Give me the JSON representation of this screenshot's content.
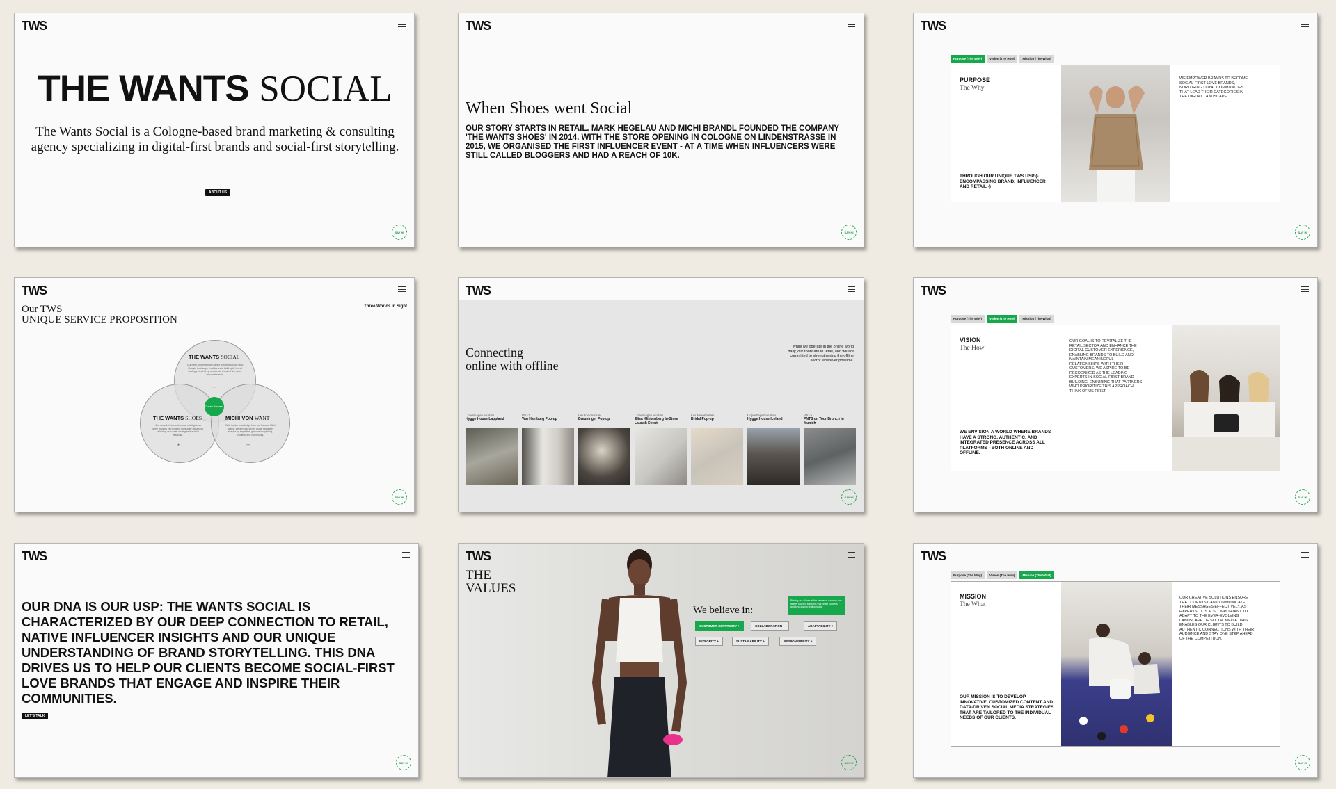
{
  "brand": {
    "logo": "TWS",
    "say_hi": "SAY HI",
    "accent": "#17a84d"
  },
  "hero": {
    "title_bold": "THE WANTS",
    "title_light": "SOCIAL",
    "description": "The Wants Social is a Cologne-based brand marketing & consulting agency specializing in digital-first brands and social-first storytelling.",
    "button": "ABOUT US"
  },
  "story": {
    "heading": "When Shoes went Social",
    "text": "OUR STORY STARTS IN RETAIL. MARK HEGELAU AND MICHI BRANDL FOUNDED THE COMPANY 'THE WANTS SHOES' IN 2014. WITH THE STORE OPENING IN COLOGNE ON LINDENSTRASSE IN 2015, WE ORGANISED THE FIRST INFLUENCER EVENT - AT A TIME WHEN INFLUENCERS WERE STILL CALLED BLOGGERS AND HAD A REACH OF 10K."
  },
  "tabs": [
    "Purpose (The Why)",
    "Vision (The How)",
    "Mission (The What)"
  ],
  "purpose": {
    "heading": "PURPOSE",
    "sub": "The Why",
    "bottom": "THROUGH OUR UNIQUE TWS USP (-ENCOMPASSING BRAND, INFLUENCER AND RETAIL -)",
    "right": "WE EMPOWER BRANDS TO BECOME SOCIAL-FIRST LOVE BRANDS, NURTURING LOYAL COMMUNITIES THAT LEAD THEIR CATEGORIES IN THE DIGITAL LANDSCAPE."
  },
  "usp": {
    "heading_line1": "Our TWS",
    "heading_line2": "UNIQUE SERVICE PROPOSITION",
    "tag": "Three Worlds in Sight",
    "core": "Classic Business",
    "circles": [
      {
        "bold": "THE WANTS",
        "light": "SOCIAL",
        "text": "Our deep understanding of the dynamic fashion and lifestyle landscape enables us to build agile brand strategies that keep our clients ahead of the curve on social media."
      },
      {
        "bold": "THE WANTS",
        "light": "SHOES",
        "text": "Our roots in brick-and-mortar retail give us deep insights into modern consumer behaviour, allowing us to craft strategies that truly resonate."
      },
      {
        "bold": "MICHI VON",
        "light": "WANT",
        "text": "With insider knowledge from our founder Michi Brandl, we develop strong social strategies shaped by expertise, genuine storytelling, content, and community."
      }
    ]
  },
  "connecting": {
    "heading_line1": "Connecting",
    "heading_line2": "online with offline",
    "text": "While we operate in the online world daily, our roots are in retail, and we are committed to strengthening the offline sector wherever possible.",
    "items": [
      {
        "client": "Copenhagen Studios",
        "title": "Hygge House Lappland"
      },
      {
        "client": "PNTS",
        "title": "Vau Hamburg Pop-up"
      },
      {
        "client": "Les Visionnaires",
        "title": "Breuninger Pop-up"
      },
      {
        "client": "Copenhagen Studios",
        "title": "Elisa Klinkenberg In-Store Launch Event"
      },
      {
        "client": "Les Visionnaires",
        "title": "Bridal Pop-up"
      },
      {
        "client": "Copenhagen Studios",
        "title": "Hygge House Iceland"
      },
      {
        "client": "PNTS",
        "title": "PNTS on Tour Brunch in Munich"
      }
    ]
  },
  "vision": {
    "heading": "VISION",
    "sub": "The How",
    "bottom": "WE ENVISION A WORLD WHERE BRANDS HAVE A STRONG, AUTHENTIC, AND INTEGRATED PRESENCE ACROSS ALL PLATFORMS - BOTH ONLINE AND OFFLINE.",
    "right": "OUR GOAL IS TO REVITALIZE THE RETAIL SECTOR AND ENHANCE THE DIGITAL CUSTOMER EXPERIENCE, ENABLING BRANDS TO BUILD AND MAINTAIN MEANINGFUL RELATIONSHIPS WITH THEIR CUSTOMERS. WE ASPIRE TO BE RECOGNIZED AS THE LEADING EXPERTS IN SOCIAL-FIRST BRAND BUILDING, ENSURING THAT PARTNERS WHO PRIORITIZE THIS APPROACH THINK OF US FIRST."
  },
  "dna": {
    "text": "OUR DNA IS OUR USP: THE WANTS SOCIAL IS CHARACTERIZED BY OUR DEEP CONNECTION TO RETAIL, NATIVE INFLUENCER INSIGHTS AND OUR UNIQUE UNDERSTANDING OF BRAND STORYTELLING. THIS DNA DRIVES US TO HELP OUR CLIENTS BECOME SOCIAL-FIRST LOVE BRANDS THAT ENGAGE AND INSPIRE THEIR COMMUNITIES.",
    "button": "LET'S TALK"
  },
  "values": {
    "heading_line1": "THE",
    "heading_line2": "VALUES",
    "believe": "We believe in:",
    "note": "Placing our clients at the centre of our work, we deliver tailored solutions that foster success and long-lasting relationships.",
    "pills": [
      "CUSTOMER-CENTRICITY",
      "COLLABORATION",
      "ADAPTABILITY",
      "INTEGRITY",
      "SUSTAINABILITY",
      "RESPONSIBILITY"
    ]
  },
  "mission": {
    "heading": "MISSION",
    "sub": "The What",
    "bottom": "OUR MISSION IS TO DEVELOP INNOVATIVE, CUSTOMIZED CONTENT AND DATA-DRIVEN SOCIAL MEDIA STRATEGIES THAT ARE TAILORED TO THE INDIVIDUAL NEEDS OF OUR CLIENTS.",
    "right": "OUR CREATIVE SOLUTIONS ENSURE THAT CLIENTS CAN COMMUNICATE THEIR MESSAGES EFFECTIVELY. AS EXPERTS, IT IS ALSO IMPORTANT TO ADAPT TO THE EVER-EVOLVING LANDSCAPE OF SOCIAL MEDIA. THIS ENABLES OUR CLIENTS TO BUILD AUTHENTIC CONNECTIONS WITH THEIR AUDIENCE AND STAY ONE STEP AHEAD OF THE COMPETITION."
  }
}
